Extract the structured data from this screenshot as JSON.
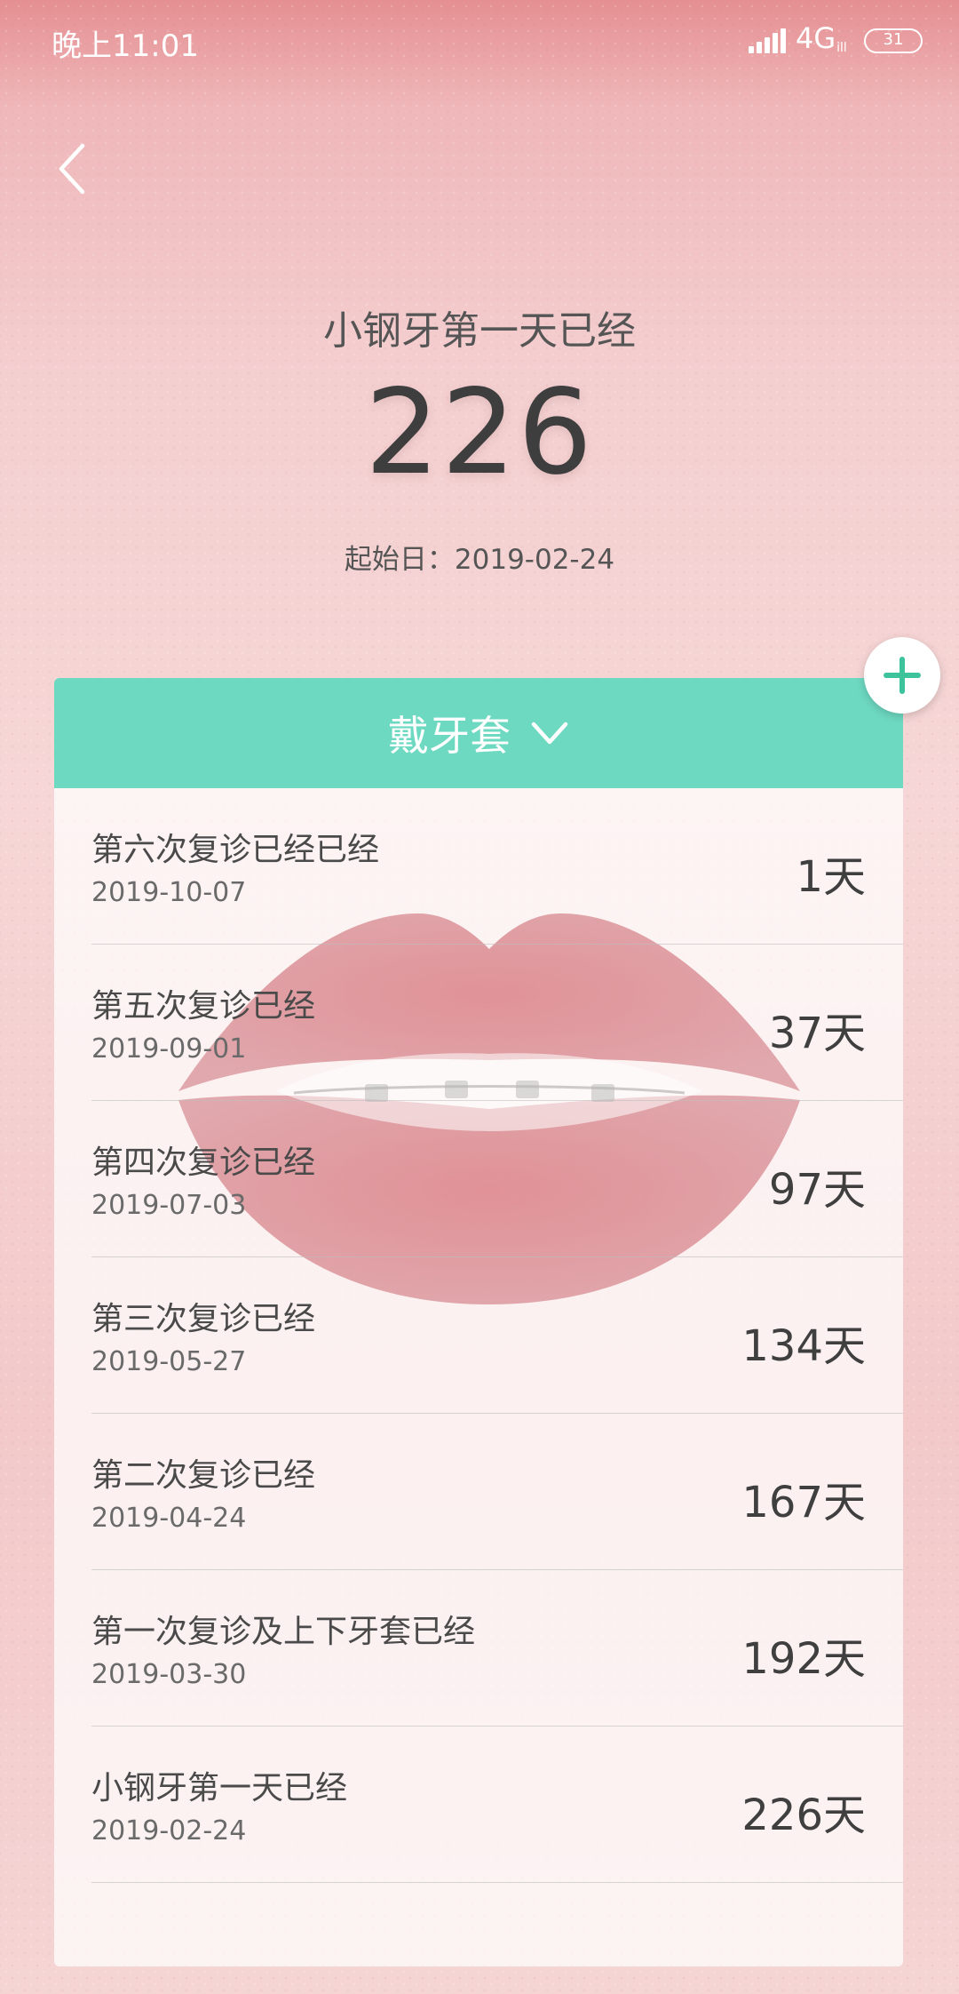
{
  "status_bar": {
    "time": "晚上11:01",
    "network": "4G",
    "network_sub": "ill",
    "battery": "31"
  },
  "header": {
    "title": "小钢牙第一天已经",
    "count": "226",
    "start_date": "起始日：2019-02-24"
  },
  "card": {
    "category_label": "戴牙套",
    "accent_color": "#6ed9c1",
    "records": [
      {
        "name": "第六次复诊已经已经",
        "date": "2019-10-07",
        "days": "1天"
      },
      {
        "name": "第五次复诊已经",
        "date": "2019-09-01",
        "days": "37天"
      },
      {
        "name": "第四次复诊已经",
        "date": "2019-07-03",
        "days": "97天"
      },
      {
        "name": "第三次复诊已经",
        "date": "2019-05-27",
        "days": "134天"
      },
      {
        "name": "第二次复诊已经",
        "date": "2019-04-24",
        "days": "167天"
      },
      {
        "name": "第一次复诊及上下牙套已经",
        "date": "2019-03-30",
        "days": "192天"
      },
      {
        "name": "小钢牙第一天已经",
        "date": "2019-02-24",
        "days": "226天"
      }
    ]
  },
  "icons": {
    "back": "back-chevron-icon",
    "dropdown": "chevron-down-icon",
    "add": "plus-icon",
    "signal": "signal-icon",
    "battery": "battery-icon"
  }
}
